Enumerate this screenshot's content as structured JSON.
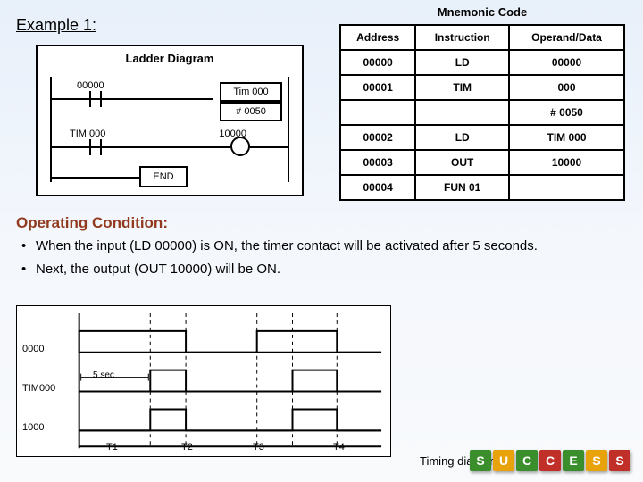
{
  "title": "Example 1:",
  "ladder": {
    "heading": "Ladder Diagram",
    "rung1_contact_label": "00000",
    "rung1_box_line1": "Tim 000",
    "rung1_box_line2": "# 0050",
    "rung2_contact_label": "TIM 000",
    "rung2_coil_label": "10000",
    "end_label": "END"
  },
  "mnemonic": {
    "heading": "Mnemonic Code",
    "cols": [
      "Address",
      "Instruction",
      "Operand/Data"
    ],
    "rows": [
      [
        "00000",
        "LD",
        "00000"
      ],
      [
        "00001",
        "TIM",
        "000"
      ],
      [
        "",
        "",
        "# 0050"
      ],
      [
        "00002",
        "LD",
        "TIM 000"
      ],
      [
        "00003",
        "OUT",
        "10000"
      ],
      [
        "00004",
        "FUN 01",
        ""
      ]
    ]
  },
  "operating": {
    "heading": "Operating Condition:",
    "bullet1": "When the input (LD 00000) is ON, the timer contact will be activated after 5 seconds.",
    "bullet2": "Next, the output (OUT 10000) will be ON."
  },
  "timing": {
    "row_labels": [
      "0000",
      "TIM000",
      "1000"
    ],
    "delay_label": "5 sec",
    "ticks": [
      "T1",
      "T2",
      "T3",
      "T4"
    ],
    "caption": "Timing diagram"
  },
  "blocks": [
    {
      "c": "#3a8f2c",
      "t": "S"
    },
    {
      "c": "#e8a20c",
      "t": "U"
    },
    {
      "c": "#3a8f2c",
      "t": "C"
    },
    {
      "c": "#c03028",
      "t": "C"
    },
    {
      "c": "#3a8f2c",
      "t": "E"
    },
    {
      "c": "#e8a20c",
      "t": "S"
    },
    {
      "c": "#c03028",
      "t": "S"
    }
  ],
  "chart_data": {
    "type": "table",
    "title": "Timing diagram",
    "description": "Digital timing for input 0000, timer TIM000, output 1000. T1..T4 are equally spaced events. TIM000 and 1000 go high 5 sec after 0000 rising edge.",
    "ticks": [
      "T1",
      "T2",
      "T3",
      "T4"
    ],
    "series": [
      {
        "name": "0000",
        "edges": [
          [
            "T1",
            "rise"
          ],
          [
            "T2",
            "fall"
          ],
          [
            "T3",
            "rise"
          ],
          [
            "T4",
            "fall"
          ]
        ]
      },
      {
        "name": "TIM000 / 1000",
        "delay_from": "0000",
        "delay_label": "5 sec",
        "edges": [
          [
            "T1+5s",
            "rise"
          ],
          [
            "T2",
            "fall"
          ],
          [
            "T3+5s",
            "rise"
          ],
          [
            "T4",
            "fall"
          ]
        ]
      }
    ]
  }
}
